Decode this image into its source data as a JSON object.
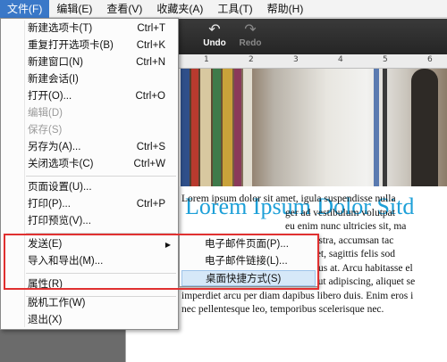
{
  "menubar": {
    "items": [
      {
        "label": "文件(F)",
        "active": true
      },
      {
        "label": "编辑(E)"
      },
      {
        "label": "查看(V)"
      },
      {
        "label": "收藏夹(A)"
      },
      {
        "label": "工具(T)"
      },
      {
        "label": "帮助(H)"
      }
    ]
  },
  "toolbar": {
    "undo_label": "Undo",
    "redo_label": "Redo"
  },
  "ruler": {
    "numbers": [
      "1",
      "2",
      "3",
      "4",
      "5",
      "6"
    ]
  },
  "document": {
    "title": "Lorem Ipsum Dolor Sitd",
    "lines": [
      "Lorem ipsum dolor sit amet, igula suspendisse nulla",
      "ger ad vestibulum volutpat",
      "eu enim nunc ultricies sit, ma",
      "igula nostra, accumsan tac",
      "ui aliquet, sagittis felis sod",
      "mauris, vel eu libero cras. Faucibus at. Arcu habitasse el",
      "ipsum purus pede porttitor class, ut adipiscing, aliquet se",
      "imperdiet arcu per diam dapibus libero duis. Enim eros i",
      "nec pellentesque leo, temporibus scelerisque nec."
    ]
  },
  "file_menu": {
    "items": [
      {
        "label": "新建选项卡(T)",
        "shortcut": "Ctrl+T"
      },
      {
        "label": "重复打开选项卡(B)",
        "shortcut": "Ctrl+K"
      },
      {
        "label": "新建窗口(N)",
        "shortcut": "Ctrl+N"
      },
      {
        "label": "新建会话(I)",
        "shortcut": ""
      },
      {
        "label": "打开(O)...",
        "shortcut": "Ctrl+O"
      },
      {
        "label": "编辑(D)",
        "shortcut": "",
        "disabled": true
      },
      {
        "label": "保存(S)",
        "shortcut": "",
        "disabled": true
      },
      {
        "label": "另存为(A)...",
        "shortcut": "Ctrl+S"
      },
      {
        "label": "关闭选项卡(C)",
        "shortcut": "Ctrl+W"
      },
      {
        "label": "页面设置(U)...",
        "shortcut": ""
      },
      {
        "label": "打印(P)...",
        "shortcut": "Ctrl+P"
      },
      {
        "label": "打印预览(V)...",
        "shortcut": ""
      },
      {
        "label": "发送(E)",
        "shortcut": "",
        "submenu": true
      },
      {
        "label": "导入和导出(M)...",
        "shortcut": ""
      },
      {
        "label": "属性(R)",
        "shortcut": ""
      },
      {
        "label": "脱机工作(W)",
        "shortcut": ""
      },
      {
        "label": "退出(X)",
        "shortcut": ""
      }
    ]
  },
  "send_submenu": {
    "items": [
      {
        "label": "电子邮件页面(P)..."
      },
      {
        "label": "电子邮件链接(L)..."
      },
      {
        "label": "桌面快捷方式(S)",
        "hover": true
      }
    ]
  },
  "colors": {
    "menubar_active": "#3a78c8",
    "highlight_border": "#e03030",
    "title_blue": "#1ea0d8",
    "submenu_hover": "#d6e8f8"
  }
}
